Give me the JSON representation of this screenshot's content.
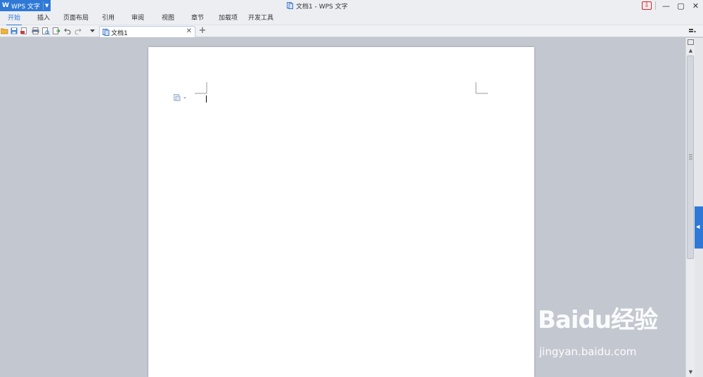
{
  "titlebar": {
    "app_menu_label": "WPS 文字",
    "window_title": "文档1 - WPS 文字"
  },
  "ribbon": {
    "tabs": [
      "开始",
      "插入",
      "页面布局",
      "引用",
      "审阅",
      "视图",
      "章节",
      "加载项",
      "开发工具"
    ],
    "active_tab": "开始"
  },
  "quick_access": {
    "icons": [
      "open-icon",
      "save-icon",
      "save-as-pdf-icon",
      "print-icon",
      "print-preview-icon",
      "export-icon",
      "undo-icon",
      "redo-icon",
      "customize-dropdown-icon"
    ]
  },
  "document_tabs": [
    {
      "label": "文档1",
      "active": true
    }
  ],
  "watermark": {
    "brand": "Baidu经验",
    "url": "jingyan.baidu.com"
  },
  "colors": {
    "accent": "#2f79d6",
    "workspace_bg": "#c3c7d0",
    "page_bg": "#ffffff"
  }
}
